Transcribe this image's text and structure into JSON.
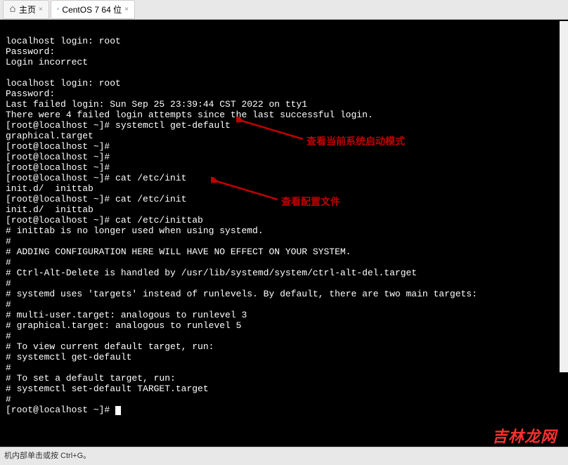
{
  "tabs": {
    "home": "主页",
    "vm": "CentOS 7 64 位"
  },
  "terminal": {
    "lines": [
      "",
      "localhost login: root",
      "Password:",
      "Login incorrect",
      "",
      "localhost login: root",
      "Password:",
      "Last failed login: Sun Sep 25 23:39:44 CST 2022 on tty1",
      "There were 4 failed login attempts since the last successful login.",
      "[root@localhost ~]# systemctl get-default",
      "graphical.target",
      "[root@localhost ~]#",
      "[root@localhost ~]#",
      "[root@localhost ~]#",
      "[root@localhost ~]# cat /etc/init",
      "init.d/  inittab",
      "[root@localhost ~]# cat /etc/init",
      "init.d/  inittab",
      "[root@localhost ~]# cat /etc/inittab",
      "# inittab is no longer used when using systemd.",
      "#",
      "# ADDING CONFIGURATION HERE WILL HAVE NO EFFECT ON YOUR SYSTEM.",
      "#",
      "# Ctrl-Alt-Delete is handled by /usr/lib/systemd/system/ctrl-alt-del.target",
      "#",
      "# systemd uses 'targets' instead of runlevels. By default, there are two main targets:",
      "#",
      "# multi-user.target: analogous to runlevel 3",
      "# graphical.target: analogous to runlevel 5",
      "#",
      "# To view current default target, run:",
      "# systemctl get-default",
      "#",
      "# To set a default target, run:",
      "# systemctl set-default TARGET.target",
      "#",
      "[root@localhost ~]# "
    ]
  },
  "annotations": {
    "anno1": "查看当前系统启动模式",
    "anno2": "查看配置文件"
  },
  "status": "机内部单击或按 Ctrl+G。",
  "watermark": "吉林龙网"
}
